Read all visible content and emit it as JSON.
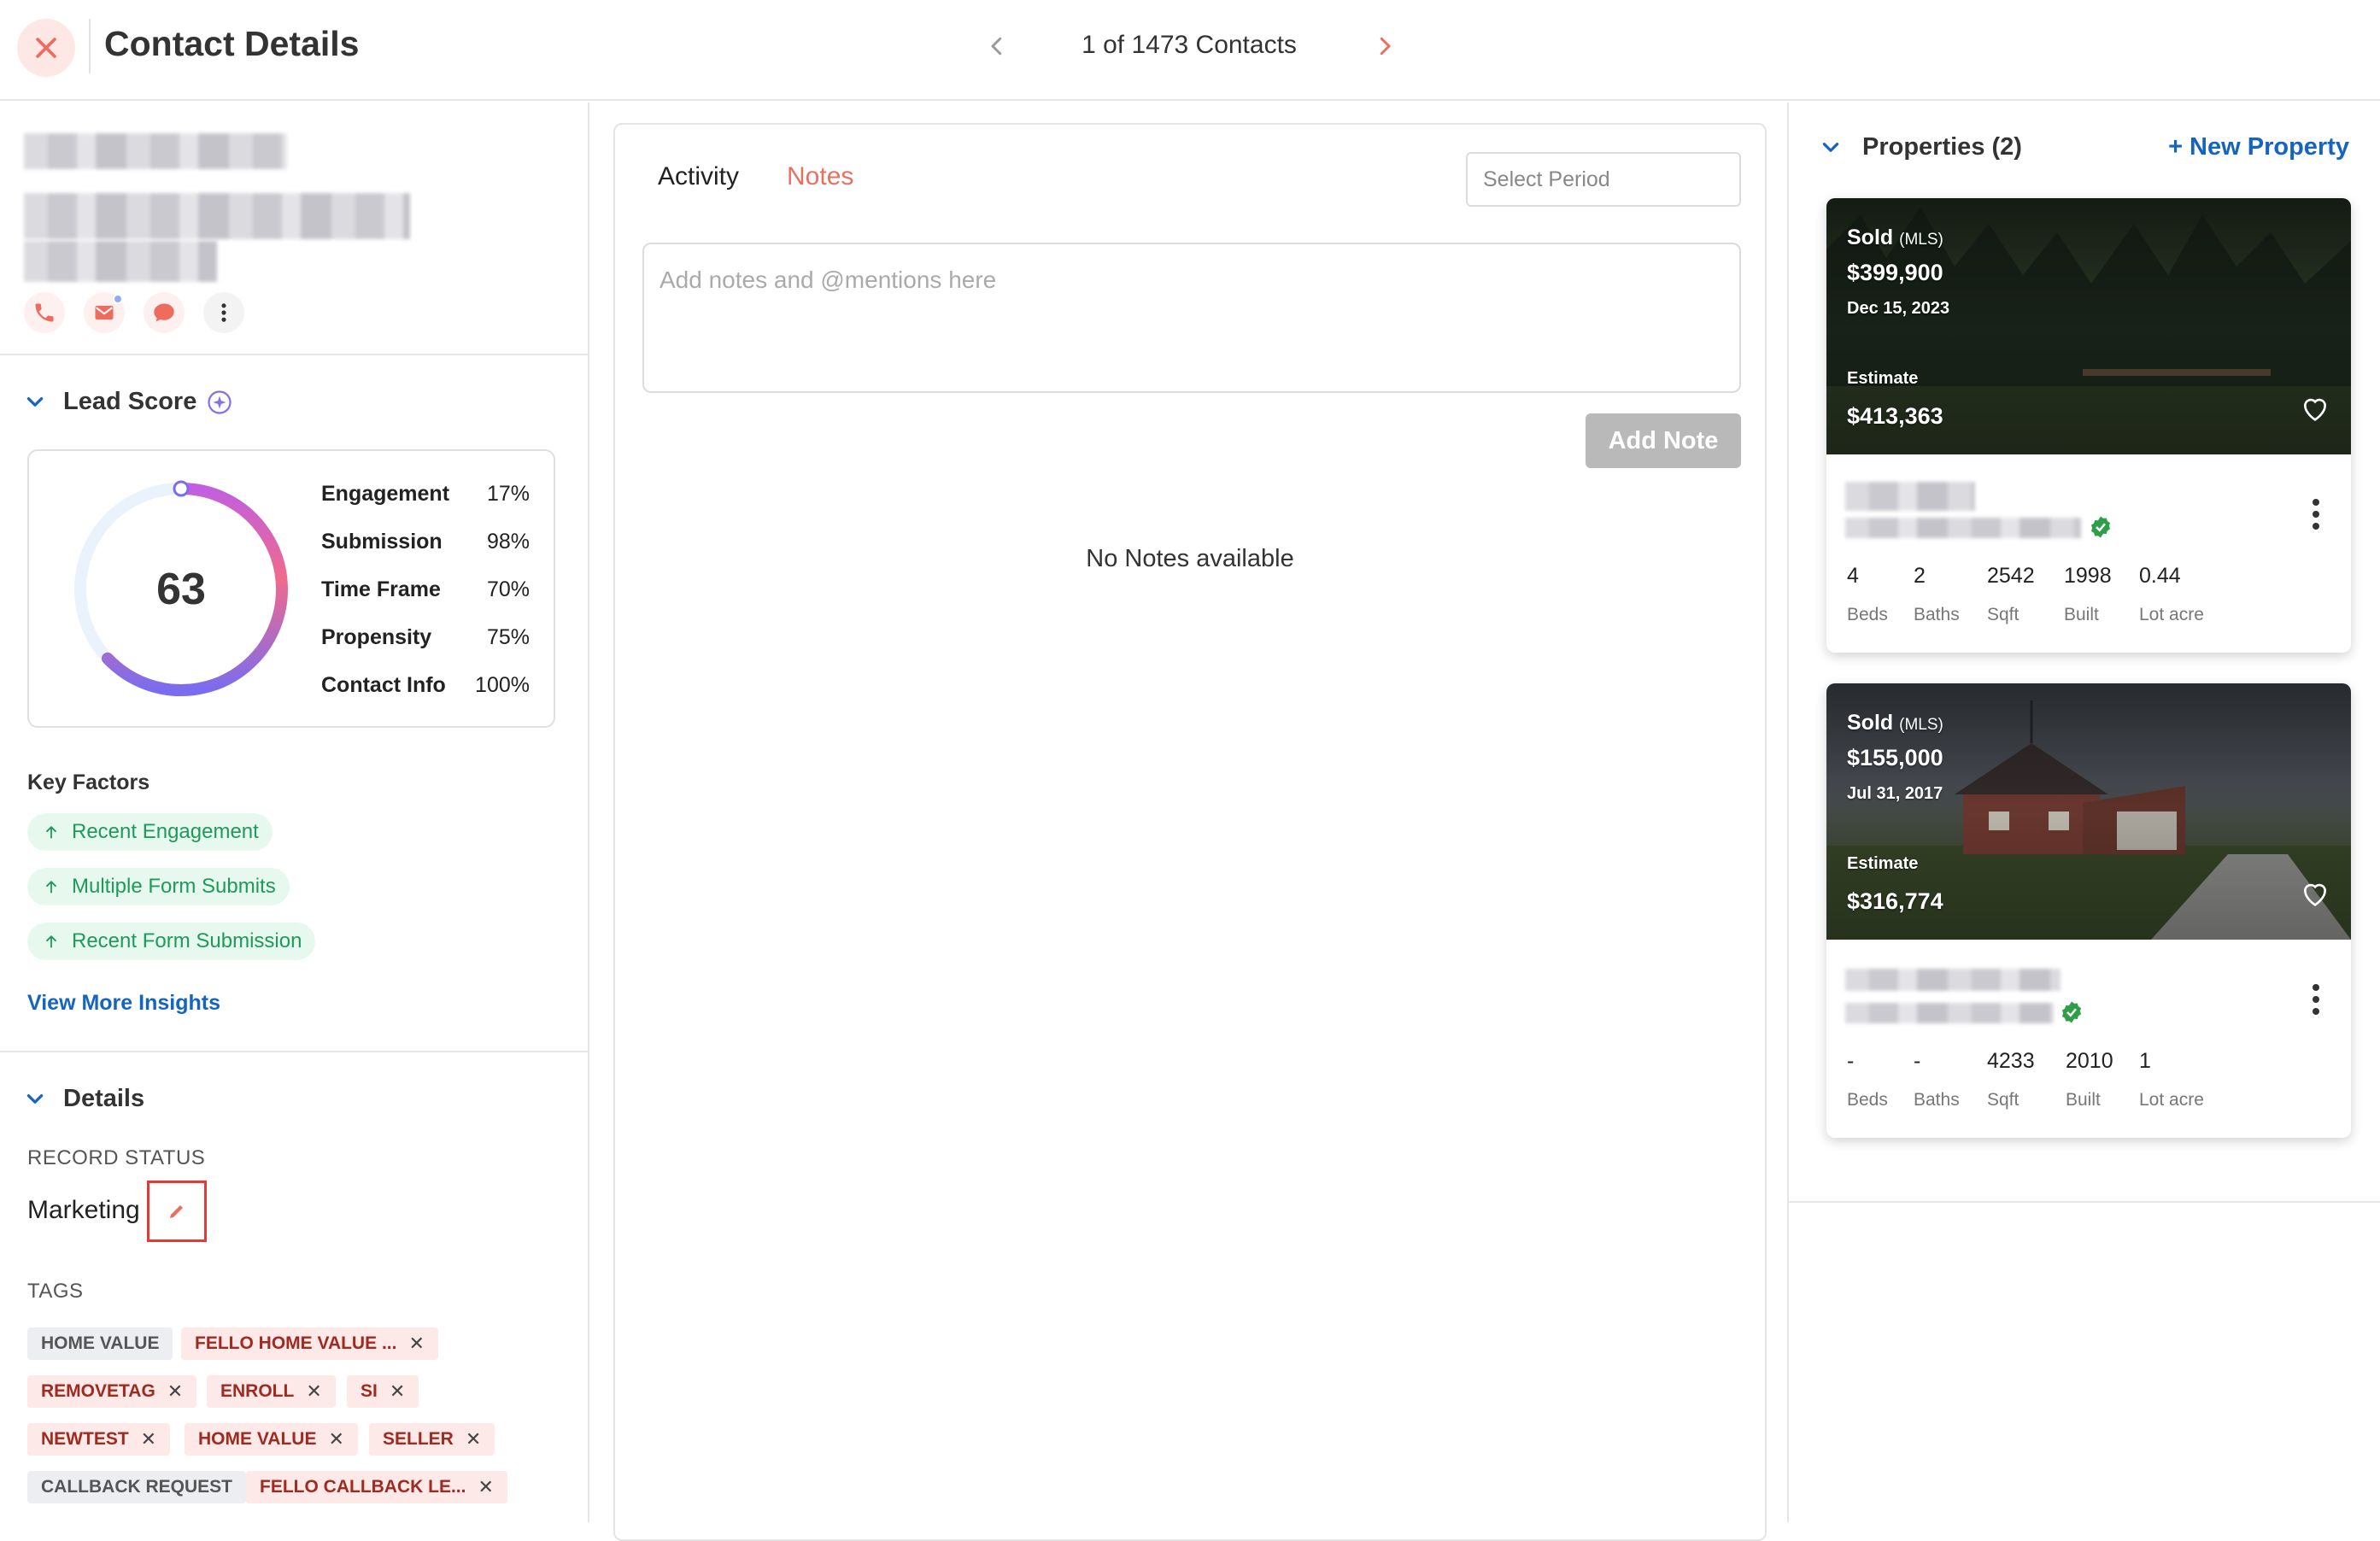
{
  "header": {
    "title": "Contact Details",
    "contact_counter": "1 of 1473 Contacts"
  },
  "lead_score": {
    "title": "Lead Score",
    "score": 63,
    "score_fraction": 0.63,
    "metrics": [
      {
        "label": "Engagement",
        "value": "17%"
      },
      {
        "label": "Submission",
        "value": "98%"
      },
      {
        "label": "Time Frame",
        "value": "70%"
      },
      {
        "label": "Propensity",
        "value": "75%"
      },
      {
        "label": "Contact Info",
        "value": "100%"
      }
    ]
  },
  "key_factors": {
    "title": "Key Factors",
    "items": [
      "Recent Engagement",
      "Multiple Form Submits",
      "Recent Form Submission"
    ],
    "more_link": "View More Insights"
  },
  "details": {
    "title": "Details",
    "record_status_label": "RECORD STATUS",
    "record_status_value": "Marketing",
    "tags_label": "TAGS",
    "tags": [
      {
        "label": "HOME VALUE",
        "removable": false
      },
      {
        "label": "FELLO HOME VALUE ...",
        "removable": true
      },
      {
        "label": "REMOVETAG",
        "removable": true
      },
      {
        "label": "ENROLL",
        "removable": true
      },
      {
        "label": "SI",
        "removable": true
      },
      {
        "label": "NEWTEST",
        "removable": true
      },
      {
        "label": "HOME VALUE",
        "removable": true
      },
      {
        "label": "SELLER",
        "removable": true
      },
      {
        "label": "CALLBACK REQUEST",
        "removable": false
      },
      {
        "label": "FELLO CALLBACK LE...",
        "removable": true
      }
    ]
  },
  "activity": {
    "tabs": [
      "Activity",
      "Notes"
    ],
    "active_tab": "Notes",
    "period_placeholder": "Select Period",
    "notes_placeholder": "Add notes and @mentions here",
    "add_note_label": "Add Note",
    "empty_text": "No Notes available"
  },
  "properties": {
    "title": "Properties (2)",
    "new_label": "+ New Property",
    "items": [
      {
        "status": "Sold",
        "source": "(MLS)",
        "price": "$399,900",
        "date": "Dec 15, 2023",
        "estimate_label": "Estimate",
        "estimate": "$413,363",
        "stats": [
          {
            "value": "4",
            "label": "Beds"
          },
          {
            "value": "2",
            "label": "Baths"
          },
          {
            "value": "2542",
            "label": "Sqft"
          },
          {
            "value": "1998",
            "label": "Built"
          },
          {
            "value": "0.44",
            "label": "Lot acre"
          }
        ]
      },
      {
        "status": "Sold",
        "source": "(MLS)",
        "price": "$155,000",
        "date": "Jul 31, 2017",
        "estimate_label": "Estimate",
        "estimate": "$316,774",
        "stats": [
          {
            "value": "-",
            "label": "Beds"
          },
          {
            "value": "-",
            "label": "Baths"
          },
          {
            "value": "4233",
            "label": "Sqft"
          },
          {
            "value": "2010",
            "label": "Built"
          },
          {
            "value": "1",
            "label": "Lot acre"
          }
        ]
      }
    ]
  },
  "colors": {
    "accent_salmon": "#e57160",
    "link_blue": "#1565c0",
    "chip_green": "#1f9a5a",
    "verified_green": "#2e9e48"
  }
}
